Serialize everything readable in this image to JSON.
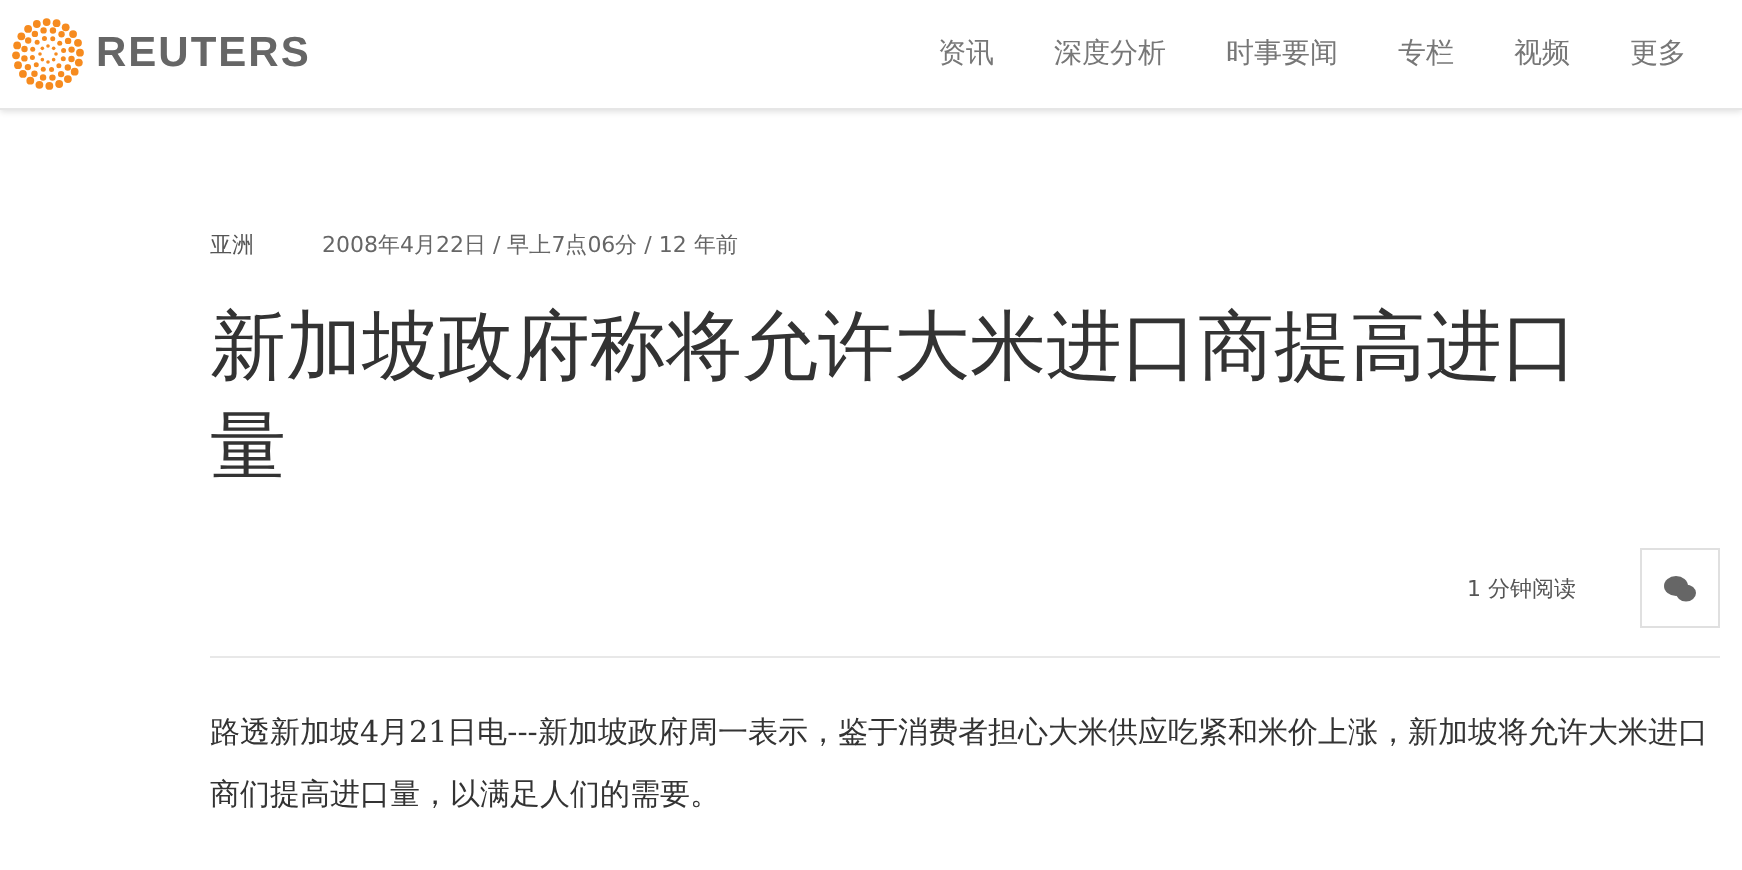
{
  "header": {
    "logo_text": "REUTERS",
    "nav": [
      {
        "label": "资讯"
      },
      {
        "label": "深度分析"
      },
      {
        "label": "时事要闻"
      },
      {
        "label": "专栏"
      },
      {
        "label": "视频"
      },
      {
        "label": "更多"
      }
    ]
  },
  "article": {
    "section": "亚洲",
    "dateline": "2008年4月22日 / 早上7点06分 / 12 年前",
    "headline": "新加坡政府称将允许大米进口商提高进口量",
    "read_time": "1 分钟阅读",
    "body": "路透新加坡4月21日电---新加坡政府周一表示，鉴于消费者担心大米供应吃紧和米价上涨，新加坡将允许大米进口商们提高进口量，以满足人们的需要。"
  }
}
